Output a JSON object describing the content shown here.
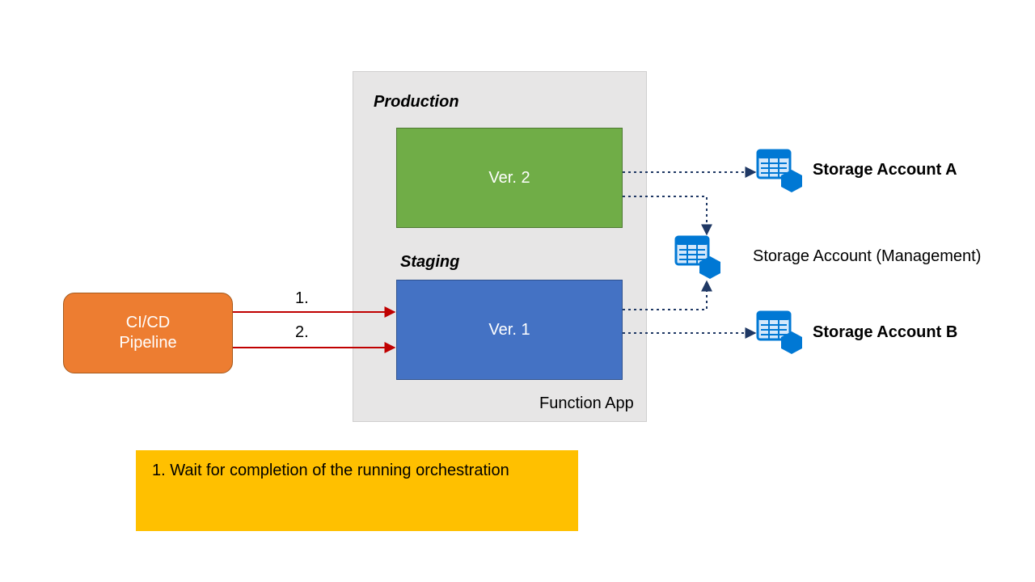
{
  "cicd": {
    "label": "CI/CD\nPipeline"
  },
  "functionApp": {
    "label": "Function App",
    "production": {
      "slotLabel": "Production",
      "versionLabel": "Ver. 2"
    },
    "staging": {
      "slotLabel": "Staging",
      "versionLabel": "Ver. 1"
    }
  },
  "steps": {
    "one": "1.",
    "two": "2."
  },
  "storage": {
    "a": {
      "label": "Storage Account A"
    },
    "management": {
      "label": "Storage Account (Management)"
    },
    "b": {
      "label": "Storage Account B"
    }
  },
  "note": {
    "text": "1. Wait for completion of  the running orchestration"
  },
  "colors": {
    "orange": "#ed7d31",
    "green": "#70ad47",
    "blue": "#4472c4",
    "azure": "#0078d4",
    "amber": "#ffc000",
    "red": "#c00000",
    "navy": "#1f3864",
    "grey": "#e7e6e6"
  }
}
